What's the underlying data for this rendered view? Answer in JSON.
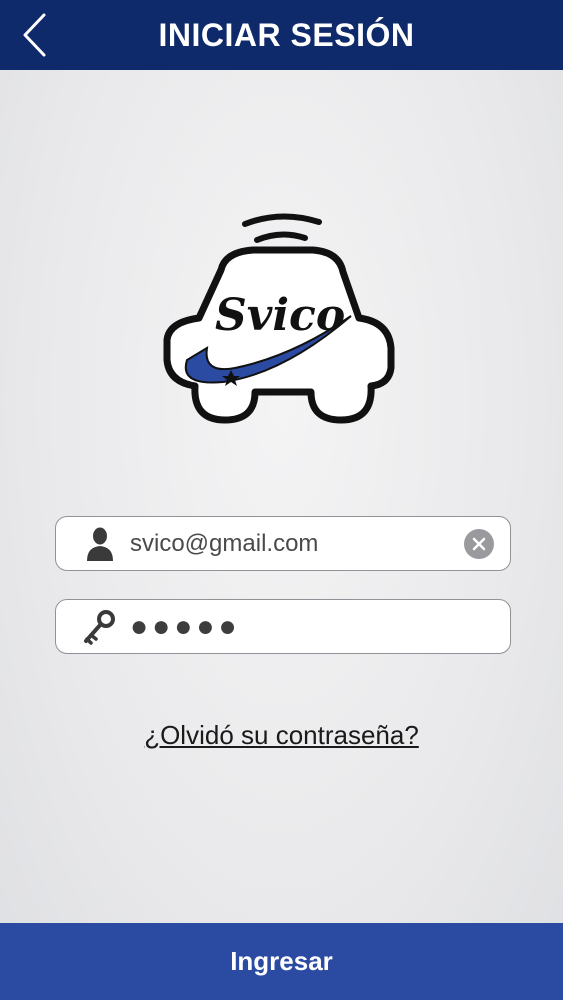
{
  "header": {
    "title": "INICIAR SESIÓN",
    "back_icon": "chevron-left-icon"
  },
  "logo": {
    "brand_text": "Svico",
    "colors": {
      "swoosh": "#2b4aa2",
      "outline": "#111111"
    }
  },
  "form": {
    "email": {
      "icon": "user-icon",
      "value": "svico@gmail.com",
      "clear_icon": "clear-icon"
    },
    "password": {
      "icon": "key-icon",
      "value": "●●●●●"
    },
    "forgot_label": "¿Olvidó su contraseña?",
    "submit_label": "Ingresar"
  },
  "colors": {
    "header_bg": "#0f2a6b",
    "button_bg": "#2b4aa2"
  }
}
